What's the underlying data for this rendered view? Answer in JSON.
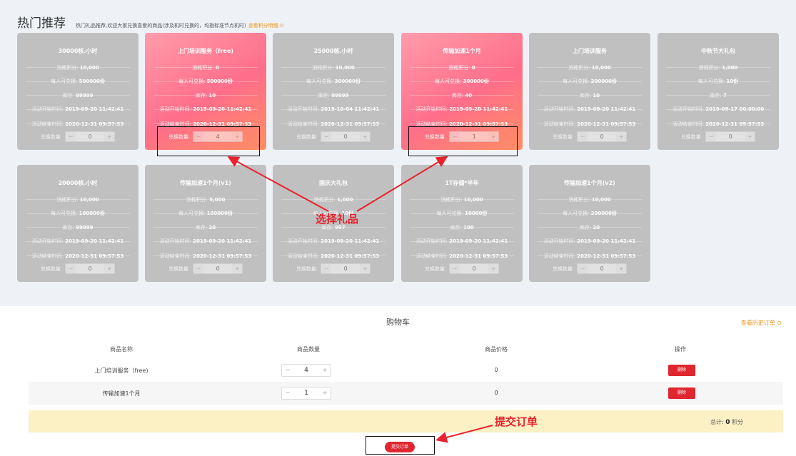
{
  "header": {
    "title": "热门推荐",
    "subtitle": "热门礼品推荐,欢迎大家兑换喜爱的商品(涉及机时兑换的，均指标准节点机时)",
    "points_link": "查看积分明细 ⊙"
  },
  "labels": {
    "cost": "消耗积分:",
    "limit": "每人可兑换:",
    "stock": "库存:",
    "start": "活动开始时间:",
    "end": "活动结束时间:",
    "qty": "兑换数量:",
    "minus": "−",
    "plus": "+"
  },
  "cards": [
    {
      "name": "30000核.小时",
      "cost": "10,000",
      "limit": "500000份",
      "stock": "99999",
      "start": "2019-09-20 11:42:41",
      "end": "2020-12-31 09:57:53",
      "qty": "0"
    },
    {
      "name": "上门培训服务（free)",
      "cost": "0",
      "limit": "500000份",
      "stock": "10",
      "start": "2019-09-20 11:42:41",
      "end": "2020-12-31 09:57:53",
      "qty": "4"
    },
    {
      "name": "25000核.小时",
      "cost": "10,000",
      "limit": "300000份",
      "stock": "99999",
      "start": "2019-10-04 11:42:41",
      "end": "2020-12-31 09:57:53",
      "qty": "0"
    },
    {
      "name": "传输加速1个月",
      "cost": "0",
      "limit": "300000份",
      "stock": "40",
      "start": "2019-09-20 11:42:41",
      "end": "2020-12-31 09:57:53",
      "qty": "1"
    },
    {
      "name": "上门培训服务",
      "cost": "10,000",
      "limit": "200000份",
      "stock": "10",
      "start": "2019-09-20 11:42:41",
      "end": "2020-12-31 09:57:53",
      "qty": "0"
    },
    {
      "name": "中秋节大礼包",
      "cost": "1,000",
      "limit": "10份",
      "stock": "7",
      "start": "2019-09-17 00:00:00",
      "end": "2020-12-31 09:57:53",
      "qty": "0"
    },
    {
      "name": "20000核.小时",
      "cost": "10,000",
      "limit": "100000份",
      "stock": "99999",
      "start": "2019-09-20 11:42:41",
      "end": "2020-12-31 09:57:53",
      "qty": "0"
    },
    {
      "name": "传输加速1个月(v1)",
      "cost": "5,000",
      "limit": "100000份",
      "stock": "20",
      "start": "2019-09-20 11:42:41",
      "end": "2020-12-31 09:57:53",
      "qty": "0"
    },
    {
      "name": "国庆大礼包",
      "cost": "1,000",
      "limit": "10份",
      "stock": "997",
      "start": "2019-09-20 11:42:41",
      "end": "2020-12-31 09:57:53",
      "qty": "0"
    },
    {
      "name": "1T存储*半年",
      "cost": "10,000",
      "limit": "10000份",
      "stock": "100",
      "start": "2019-09-20 11:42:41",
      "end": "2020-12-31 09:57:53",
      "qty": "0"
    },
    {
      "name": "传输加速1个月(v2)",
      "cost": "10,000",
      "limit": "200000份",
      "stock": "20",
      "start": "2019-09-20 11:42:41",
      "end": "2020-12-31 09:57:53",
      "qty": "0"
    }
  ],
  "annotations": {
    "select_gift": "选择礼品",
    "submit_order": "提交订单"
  },
  "cart": {
    "title": "购物车",
    "history_link": "查看历史订单 ⊙",
    "columns": [
      "商品名称",
      "商品数量",
      "商品价格",
      "操作"
    ],
    "rows": [
      {
        "name": "上门培训服务（free)",
        "qty": "4",
        "price": "0",
        "action": "删除"
      },
      {
        "name": "传输加速1个月",
        "qty": "1",
        "price": "0",
        "action": "删除"
      }
    ],
    "total_label": "总计:",
    "total_value": "0",
    "total_unit": "积分",
    "submit_label": "提交订单"
  },
  "colors": {
    "card_bg": "#c0c0c0",
    "highlight_gradient": [
      "#ff9cab",
      "#ff6e8a",
      "#ff8e63"
    ],
    "accent_orange": "#f0921d",
    "danger_red": "#e0262f",
    "total_bar": "#fcf0c5"
  }
}
